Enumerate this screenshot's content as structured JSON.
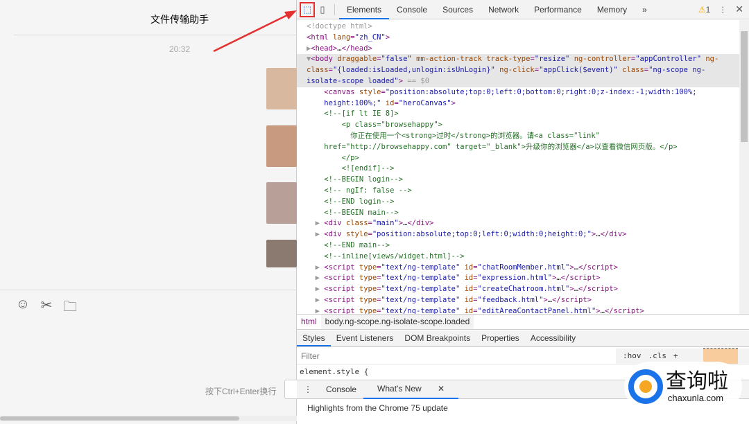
{
  "chat": {
    "title": "文件传输助手",
    "time": "20:32",
    "hint": "按下Ctrl+Enter换行",
    "tools": [
      {
        "icon": "emoji-icon",
        "glyph": "☺"
      },
      {
        "icon": "scissors-icon",
        "glyph": "✂"
      },
      {
        "icon": "folder-icon",
        "glyph": "🗀"
      }
    ],
    "avatar_colors": [
      "#d9b8a0",
      "#c89a80",
      "#b8a098",
      "#8a7a70"
    ]
  },
  "devtools": {
    "tabs": [
      "Elements",
      "Console",
      "Sources",
      "Network",
      "Performance",
      "Memory"
    ],
    "more": "»",
    "warning_count": "1",
    "warning_icon": "⚠",
    "code": [
      [
        [
          "g",
          "<!doctype html>"
        ]
      ],
      [
        [
          "t",
          "<html "
        ],
        [
          "a",
          "lang"
        ],
        [
          "t",
          "="
        ],
        [
          "v",
          "\"zh_CN\""
        ],
        [
          "t",
          ">"
        ]
      ],
      [
        [
          "g",
          "▶"
        ],
        [
          "t",
          "<head>"
        ],
        [
          "x",
          "…"
        ],
        [
          "t",
          "</head>"
        ]
      ],
      [
        [
          "g",
          "▼"
        ],
        [
          "t",
          "<body "
        ],
        [
          "a",
          "draggable"
        ],
        [
          "t",
          "="
        ],
        [
          "v",
          "\"false\" "
        ],
        [
          "a",
          "mm-action-track track-type"
        ],
        [
          "t",
          "="
        ],
        [
          "v",
          "\"resize\" "
        ],
        [
          "a",
          "ng-controller"
        ],
        [
          "t",
          "="
        ],
        [
          "v",
          "\"appController\" "
        ],
        [
          "a",
          "ng-"
        ]
      ],
      [
        [
          "a",
          "class"
        ],
        [
          "t",
          "="
        ],
        [
          "v",
          "\"{loaded:isLoaded,unlogin:isUnLogin}\" "
        ],
        [
          "a",
          "ng-click"
        ],
        [
          "t",
          "="
        ],
        [
          "v",
          "\"appClick($event)\" "
        ],
        [
          "a",
          "class"
        ],
        [
          "t",
          "="
        ],
        [
          "v",
          "\"ng-scope ng-"
        ]
      ],
      [
        [
          "v",
          "isolate-scope loaded\""
        ],
        [
          "t",
          ">"
        ],
        [
          "g",
          " == $0"
        ]
      ],
      [
        [
          "t",
          "    <canvas "
        ],
        [
          "a",
          "style"
        ],
        [
          "t",
          "="
        ],
        [
          "v",
          "\"position:absolute;top:0;left:0;bottom:0;right:0;z-index:-1;width:100%;"
        ]
      ],
      [
        [
          "v",
          "    height:100%;\" "
        ],
        [
          "a",
          "id"
        ],
        [
          "t",
          "="
        ],
        [
          "v",
          "\"heroCanvas\""
        ],
        [
          "t",
          ">"
        ]
      ],
      [
        [
          "c",
          "    <!--[if lt IE 8]>"
        ]
      ],
      [
        [
          "c",
          "        <p class=\"browsehappy\">"
        ]
      ],
      [
        [
          "c",
          "          你正在使用一个<strong>过时</strong>的浏览器。请<a class=\"link\""
        ]
      ],
      [
        [
          "c",
          "    href=\"http://browsehappy.com\" target=\"_blank\">升级你的浏览器</a>以查看微信网页版。</p>"
        ]
      ],
      [
        [
          "c",
          "        </p>"
        ]
      ],
      [
        [
          "c",
          "        <![endif]-->"
        ]
      ],
      [
        [
          "c",
          "    <!--BEGIN login-->"
        ]
      ],
      [
        [
          "c",
          "    <!-- ngIf: false -->"
        ]
      ],
      [
        [
          "c",
          "    <!--END login-->"
        ]
      ],
      [
        [
          "c",
          "    <!--BEGIN main-->"
        ]
      ],
      [
        [
          "g",
          "  ▶ "
        ],
        [
          "t",
          "<div "
        ],
        [
          "a",
          "class"
        ],
        [
          "t",
          "="
        ],
        [
          "v",
          "\"main\""
        ],
        [
          "t",
          ">"
        ],
        [
          "x",
          "…"
        ],
        [
          "t",
          "</div>"
        ]
      ],
      [
        [
          "g",
          "  ▶ "
        ],
        [
          "t",
          "<div "
        ],
        [
          "a",
          "style"
        ],
        [
          "t",
          "="
        ],
        [
          "v",
          "\"position:absolute;top:0;left:0;width:0;height:0;\""
        ],
        [
          "t",
          ">"
        ],
        [
          "x",
          "…"
        ],
        [
          "t",
          "</div>"
        ]
      ],
      [
        [
          "c",
          "    <!--END main-->"
        ]
      ],
      [
        [
          "c",
          "    <!--inline[views/widget.html]-->"
        ]
      ],
      [
        [
          "g",
          "  ▶ "
        ],
        [
          "t",
          "<script "
        ],
        [
          "a",
          "type"
        ],
        [
          "t",
          "="
        ],
        [
          "v",
          "\"text/ng-template\" "
        ],
        [
          "a",
          "id"
        ],
        [
          "t",
          "="
        ],
        [
          "v",
          "\"chatRoomMember.html\""
        ],
        [
          "t",
          ">"
        ],
        [
          "x",
          "…"
        ],
        [
          "t",
          "</script>"
        ]
      ],
      [
        [
          "g",
          "  ▶ "
        ],
        [
          "t",
          "<script "
        ],
        [
          "a",
          "type"
        ],
        [
          "t",
          "="
        ],
        [
          "v",
          "\"text/ng-template\" "
        ],
        [
          "a",
          "id"
        ],
        [
          "t",
          "="
        ],
        [
          "v",
          "\"expression.html\""
        ],
        [
          "t",
          ">"
        ],
        [
          "x",
          "…"
        ],
        [
          "t",
          "</script>"
        ]
      ],
      [
        [
          "g",
          "  ▶ "
        ],
        [
          "t",
          "<script "
        ],
        [
          "a",
          "type"
        ],
        [
          "t",
          "="
        ],
        [
          "v",
          "\"text/ng-template\" "
        ],
        [
          "a",
          "id"
        ],
        [
          "t",
          "="
        ],
        [
          "v",
          "\"createChatroom.html\""
        ],
        [
          "t",
          ">"
        ],
        [
          "x",
          "…"
        ],
        [
          "t",
          "</script>"
        ]
      ],
      [
        [
          "g",
          "  ▶ "
        ],
        [
          "t",
          "<script "
        ],
        [
          "a",
          "type"
        ],
        [
          "t",
          "="
        ],
        [
          "v",
          "\"text/ng-template\" "
        ],
        [
          "a",
          "id"
        ],
        [
          "t",
          "="
        ],
        [
          "v",
          "\"feedback.html\""
        ],
        [
          "t",
          ">"
        ],
        [
          "x",
          "…"
        ],
        [
          "t",
          "</script>"
        ]
      ],
      [
        [
          "g",
          "  ▶ "
        ],
        [
          "t",
          "<script "
        ],
        [
          "a",
          "type"
        ],
        [
          "t",
          "="
        ],
        [
          "v",
          "\"text/ng-template\" "
        ],
        [
          "a",
          "id"
        ],
        [
          "t",
          "="
        ],
        [
          "v",
          "\"editAreaContactPanel.html\""
        ],
        [
          "t",
          ">"
        ],
        [
          "x",
          "…"
        ],
        [
          "t",
          "</script>"
        ]
      ]
    ],
    "breadcrumb": [
      "html",
      "body.ng-scope.ng-isolate-scope.loaded"
    ],
    "style_tabs": [
      "Styles",
      "Event Listeners",
      "DOM Breakpoints",
      "Properties",
      "Accessibility"
    ],
    "filter_placeholder": "Filter",
    "hov": ":hov",
    "cls": ".cls",
    "plus": "+",
    "element_style": "element.style {",
    "drawer_tabs": [
      "Console",
      "What's New"
    ],
    "highlights": "Highlights from the Chrome 75 update"
  },
  "watermark": {
    "name": "查询啦",
    "domain": "chaxunla.com"
  }
}
